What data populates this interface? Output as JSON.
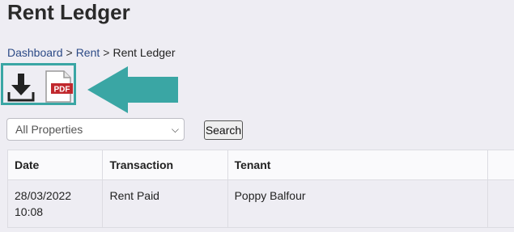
{
  "page": {
    "title": "Rent Ledger"
  },
  "breadcrumb": {
    "items": [
      "Dashboard",
      "Rent"
    ],
    "current": "Rent Ledger",
    "separator": ">"
  },
  "export": {
    "download_icon": "download-icon",
    "pdf_icon": "pdf-icon",
    "pdf_label": "PDF",
    "highlight_color": "#3aa6a4"
  },
  "filter": {
    "selected": "All Properties",
    "search_label": "Search"
  },
  "table": {
    "headers": [
      "Date",
      "Transaction",
      "Tenant"
    ],
    "rows": [
      {
        "date": "28/03/2022",
        "time": "10:08",
        "transaction": "Rent Paid",
        "tenant": "Poppy Balfour"
      }
    ]
  },
  "colors": {
    "accent": "#3aa6a4",
    "link": "#2c4a86",
    "pdf_red": "#c0282d"
  }
}
